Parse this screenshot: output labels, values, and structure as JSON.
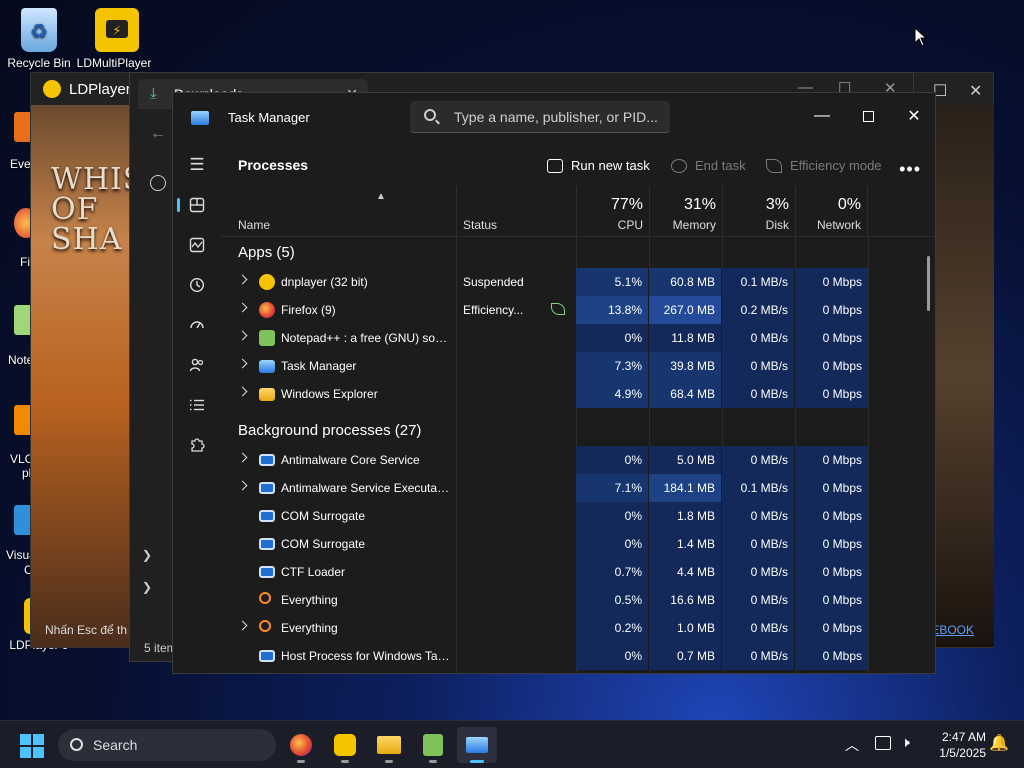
{
  "desktop": {
    "icons": [
      {
        "label": "Recycle Bin"
      },
      {
        "label": "LDMultiPlayer"
      },
      {
        "label": "LDPlayer 9"
      }
    ],
    "partial_labels": [
      "Ever",
      "Fi",
      "Note",
      "VLC",
      "pl",
      "Visua",
      "C"
    ]
  },
  "ldplayer": {
    "title": "LDPlayer",
    "game_title": "WHIS OF SHA",
    "footer_hint": "Nhấn Esc để th",
    "footer_link": "EBOOK"
  },
  "downloads": {
    "tab_title": "Downloads",
    "status": "5 item"
  },
  "task_manager": {
    "title": "Task Manager",
    "search_placeholder": "Type a name, publisher, or PID...",
    "page_title": "Processes",
    "toolbar": {
      "run_new_task": "Run new task",
      "end_task": "End task",
      "efficiency_mode": "Efficiency mode"
    },
    "columns": {
      "name": "Name",
      "status": "Status",
      "cpu": {
        "pct": "77%",
        "label": "CPU"
      },
      "memory": {
        "pct": "31%",
        "label": "Memory"
      },
      "disk": {
        "pct": "3%",
        "label": "Disk"
      },
      "network": {
        "pct": "0%",
        "label": "Network"
      }
    },
    "sections": {
      "apps": "Apps (5)",
      "background": "Background processes (27)"
    },
    "apps": [
      {
        "name": "dnplayer (32 bit)",
        "status": "Suspended",
        "cpu": "5.1%",
        "mem": "60.8 MB",
        "disk": "0.1 MB/s",
        "net": "0 Mbps"
      },
      {
        "name": "Firefox (9)",
        "status": "Efficiency...",
        "cpu": "13.8%",
        "mem": "267.0 MB",
        "disk": "0.2 MB/s",
        "net": "0 Mbps"
      },
      {
        "name": "Notepad++ : a free (GNU) sou...",
        "status": "",
        "cpu": "0%",
        "mem": "11.8 MB",
        "disk": "0 MB/s",
        "net": "0 Mbps"
      },
      {
        "name": "Task Manager",
        "status": "",
        "cpu": "7.3%",
        "mem": "39.8 MB",
        "disk": "0 MB/s",
        "net": "0 Mbps"
      },
      {
        "name": "Windows Explorer",
        "status": "",
        "cpu": "4.9%",
        "mem": "68.4 MB",
        "disk": "0 MB/s",
        "net": "0 Mbps"
      }
    ],
    "background": [
      {
        "name": "Antimalware Core Service",
        "cpu": "0%",
        "mem": "5.0 MB",
        "disk": "0 MB/s",
        "net": "0 Mbps"
      },
      {
        "name": "Antimalware Service Executable",
        "cpu": "7.1%",
        "mem": "184.1 MB",
        "disk": "0.1 MB/s",
        "net": "0 Mbps"
      },
      {
        "name": "COM Surrogate",
        "cpu": "0%",
        "mem": "1.8 MB",
        "disk": "0 MB/s",
        "net": "0 Mbps"
      },
      {
        "name": "COM Surrogate",
        "cpu": "0%",
        "mem": "1.4 MB",
        "disk": "0 MB/s",
        "net": "0 Mbps"
      },
      {
        "name": "CTF Loader",
        "cpu": "0.7%",
        "mem": "4.4 MB",
        "disk": "0 MB/s",
        "net": "0 Mbps"
      },
      {
        "name": "Everything",
        "cpu": "0.5%",
        "mem": "16.6 MB",
        "disk": "0 MB/s",
        "net": "0 Mbps"
      },
      {
        "name": "Everything",
        "cpu": "0.2%",
        "mem": "1.0 MB",
        "disk": "0 MB/s",
        "net": "0 Mbps"
      },
      {
        "name": "Host Process for Windows Tasks",
        "cpu": "0%",
        "mem": "0.7 MB",
        "disk": "0 MB/s",
        "net": "0 Mbps"
      }
    ]
  },
  "taskbar": {
    "search_label": "Search",
    "time": "2:47 AM",
    "date": "1/5/2025"
  },
  "colors": {
    "accent": "#4cc2ff",
    "heat_low": "#12295a",
    "heat_high": "#244b9a"
  }
}
